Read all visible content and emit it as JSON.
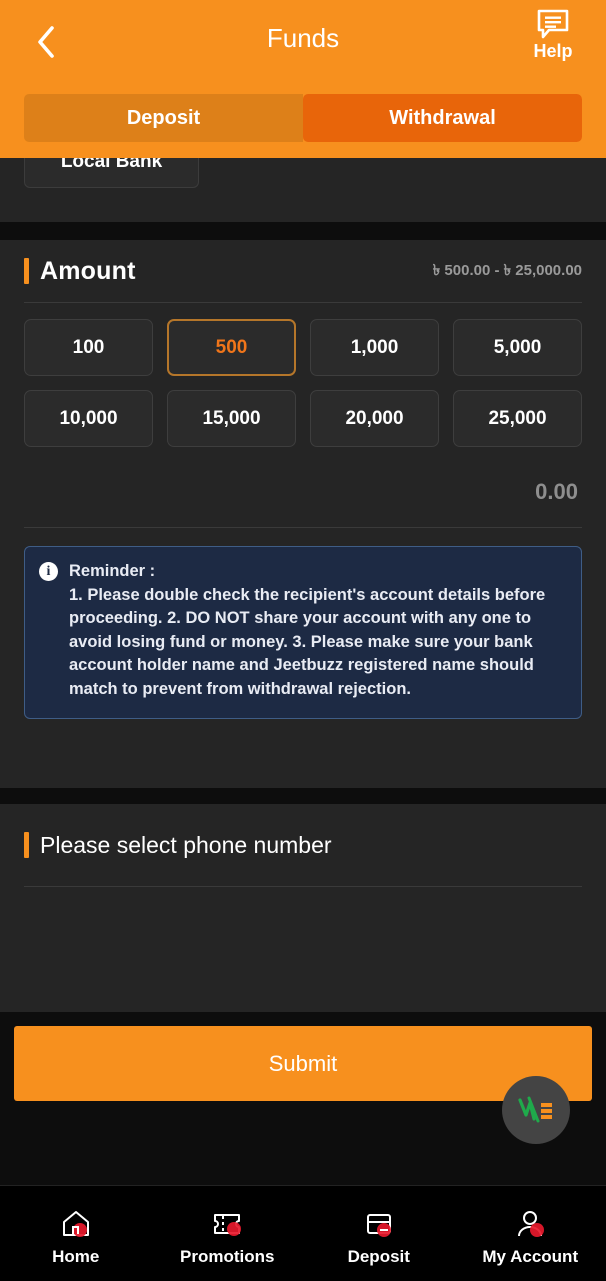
{
  "header": {
    "title": "Funds",
    "back_icon": "chevron-left-icon",
    "help_label": "Help",
    "help_icon": "speech-bubble-icon",
    "bg_color": "#f7901e",
    "tabs": [
      {
        "label": "Deposit",
        "active": false
      },
      {
        "label": "Withdrawal",
        "active": true
      }
    ]
  },
  "channel": {
    "button_label": "Local Bank"
  },
  "amount": {
    "title": "Amount",
    "range": "৳ 500.00 - ৳ 25,000.00",
    "chips": [
      {
        "label": "100",
        "selected": false
      },
      {
        "label": "500",
        "selected": true
      },
      {
        "label": "1,000",
        "selected": false
      },
      {
        "label": "5,000",
        "selected": false
      },
      {
        "label": "10,000",
        "selected": false
      },
      {
        "label": "15,000",
        "selected": false
      },
      {
        "label": "20,000",
        "selected": false
      },
      {
        "label": "25,000",
        "selected": false
      }
    ],
    "entered_value": "0.00",
    "accent_color": "#f7901e",
    "selected_border_color": "#b5762a",
    "selected_text_color": "#f0751a"
  },
  "reminder": {
    "icon": "info-icon",
    "title": "Reminder :",
    "lines": [
      "1. Please double check the recipient's account details before proceeding.",
      "2. DO NOT share your account with any one to avoid losing fund or money.",
      "3. Please make sure your bank account holder name and Jeetbuzz registered name should match to prevent from withdrawal rejection."
    ],
    "bg_color": "#1d2a44",
    "border_color": "#3f5d86"
  },
  "phone": {
    "title": "Please select phone number"
  },
  "submit": {
    "label": "Submit",
    "color": "#f7901e"
  },
  "float_logo": {
    "name": "jeetbuzz-logo",
    "letters": "JB",
    "green": "#1faa4b",
    "orange": "#f7901e"
  },
  "bottom_nav": [
    {
      "label": "Home",
      "icon": "home-icon"
    },
    {
      "label": "Promotions",
      "icon": "ticket-icon"
    },
    {
      "label": "Deposit",
      "icon": "card-icon"
    },
    {
      "label": "My Account",
      "icon": "user-icon"
    }
  ]
}
